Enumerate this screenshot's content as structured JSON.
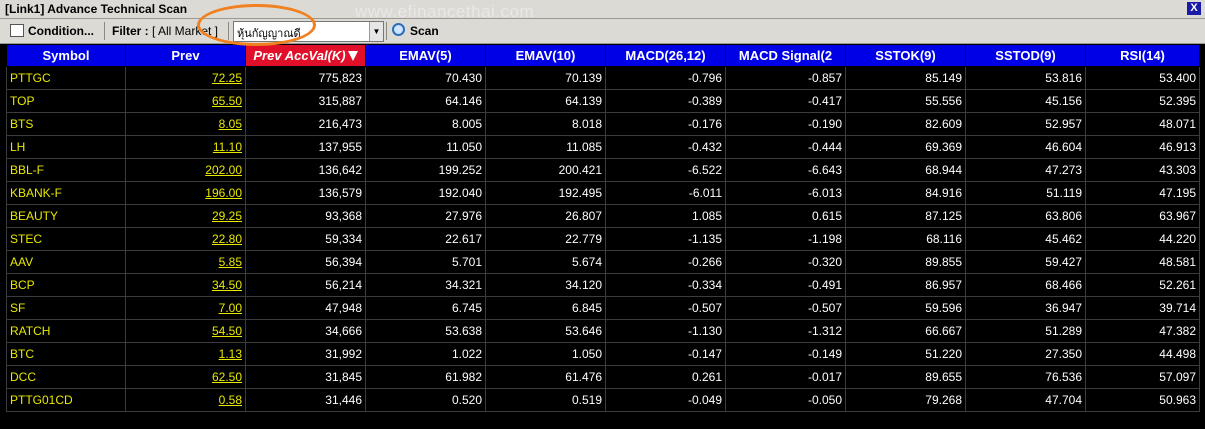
{
  "window": {
    "title": "[Link1] Advance Technical Scan",
    "watermark": "www.efinancethai.com",
    "close_label": "X"
  },
  "toolbar": {
    "condition_label": "Condition...",
    "filter_label": "Filter :",
    "filter_value": "[ All Market ]",
    "group_select_value": "หุ้นกัญญาณดี",
    "scan_label": "Scan"
  },
  "table": {
    "columns": [
      "Symbol",
      "Prev",
      "Prev AccVal(K)",
      "EMAV(5)",
      "EMAV(10)",
      "MACD(26,12)",
      "MACD Signal(2",
      "SSTOK(9)",
      "SSTOD(9)",
      "RSI(14)"
    ],
    "sorted_column": "Prev AccVal(K)",
    "rows": [
      [
        "PTTGC",
        "72.25",
        "775,823",
        "70.430",
        "70.139",
        "-0.796",
        "-0.857",
        "85.149",
        "53.816",
        "53.400"
      ],
      [
        "TOP",
        "65.50",
        "315,887",
        "64.146",
        "64.139",
        "-0.389",
        "-0.417",
        "55.556",
        "45.156",
        "52.395"
      ],
      [
        "BTS",
        "8.05",
        "216,473",
        "8.005",
        "8.018",
        "-0.176",
        "-0.190",
        "82.609",
        "52.957",
        "48.071"
      ],
      [
        "LH",
        "11.10",
        "137,955",
        "11.050",
        "11.085",
        "-0.432",
        "-0.444",
        "69.369",
        "46.604",
        "46.913"
      ],
      [
        "BBL-F",
        "202.00",
        "136,642",
        "199.252",
        "200.421",
        "-6.522",
        "-6.643",
        "68.944",
        "47.273",
        "43.303"
      ],
      [
        "KBANK-F",
        "196.00",
        "136,579",
        "192.040",
        "192.495",
        "-6.011",
        "-6.013",
        "84.916",
        "51.119",
        "47.195"
      ],
      [
        "BEAUTY",
        "29.25",
        "93,368",
        "27.976",
        "26.807",
        "1.085",
        "0.615",
        "87.125",
        "63.806",
        "63.967"
      ],
      [
        "STEC",
        "22.80",
        "59,334",
        "22.617",
        "22.779",
        "-1.135",
        "-1.198",
        "68.116",
        "45.462",
        "44.220"
      ],
      [
        "AAV",
        "5.85",
        "56,394",
        "5.701",
        "5.674",
        "-0.266",
        "-0.320",
        "89.855",
        "59.427",
        "48.581"
      ],
      [
        "BCP",
        "34.50",
        "56,214",
        "34.321",
        "34.120",
        "-0.334",
        "-0.491",
        "86.957",
        "68.466",
        "52.261"
      ],
      [
        "SF",
        "7.00",
        "47,948",
        "6.745",
        "6.845",
        "-0.507",
        "-0.507",
        "59.596",
        "36.947",
        "39.714"
      ],
      [
        "RATCH",
        "54.50",
        "34,666",
        "53.638",
        "53.646",
        "-1.130",
        "-1.312",
        "66.667",
        "51.289",
        "47.382"
      ],
      [
        "BTC",
        "1.13",
        "31,992",
        "1.022",
        "1.050",
        "-0.147",
        "-0.149",
        "51.220",
        "27.350",
        "44.498"
      ],
      [
        "DCC",
        "62.50",
        "31,845",
        "61.982",
        "61.476",
        "0.261",
        "-0.017",
        "89.655",
        "76.536",
        "57.097"
      ],
      [
        "PTTG01CD",
        "0.58",
        "31,446",
        "0.520",
        "0.519",
        "-0.049",
        "-0.050",
        "79.268",
        "47.704",
        "50.963"
      ]
    ]
  },
  "colors": {
    "header_bg": "#0000e6",
    "sorted_header_bg": "#e0102a",
    "symbol_text": "#e8e800",
    "value_text": "#ffffff",
    "highlight_ring": "#f08020"
  }
}
